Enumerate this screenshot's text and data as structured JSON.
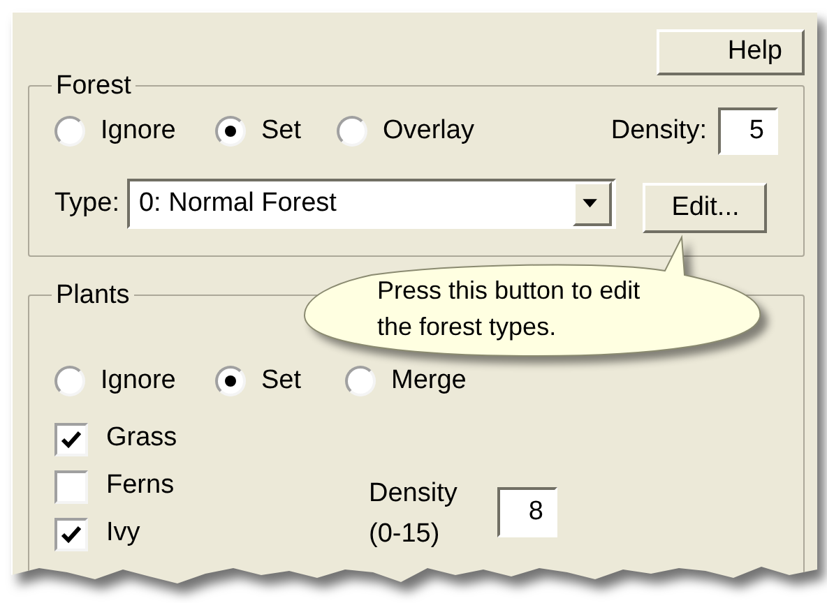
{
  "help_button": "Help",
  "forest": {
    "title": "Forest",
    "modes": [
      {
        "label": "Ignore",
        "selected": false
      },
      {
        "label": "Set",
        "selected": true
      },
      {
        "label": "Overlay",
        "selected": false
      }
    ],
    "density_label": "Density:",
    "density": "5",
    "type_label": "Type:",
    "type": "0: Normal Forest",
    "edit_button": "Edit..."
  },
  "callout": {
    "text": "Press this button to edit the forest types."
  },
  "plants": {
    "title": "Plants",
    "modes": [
      {
        "label": "Ignore",
        "selected": false
      },
      {
        "label": "Set",
        "selected": true
      },
      {
        "label": "Merge",
        "selected": false
      }
    ],
    "items": [
      {
        "label": "Grass",
        "checked": true
      },
      {
        "label": "Ferns",
        "checked": false
      },
      {
        "label": "Ivy",
        "checked": true
      }
    ],
    "density_label": "Density (0-15)",
    "density": "8"
  }
}
